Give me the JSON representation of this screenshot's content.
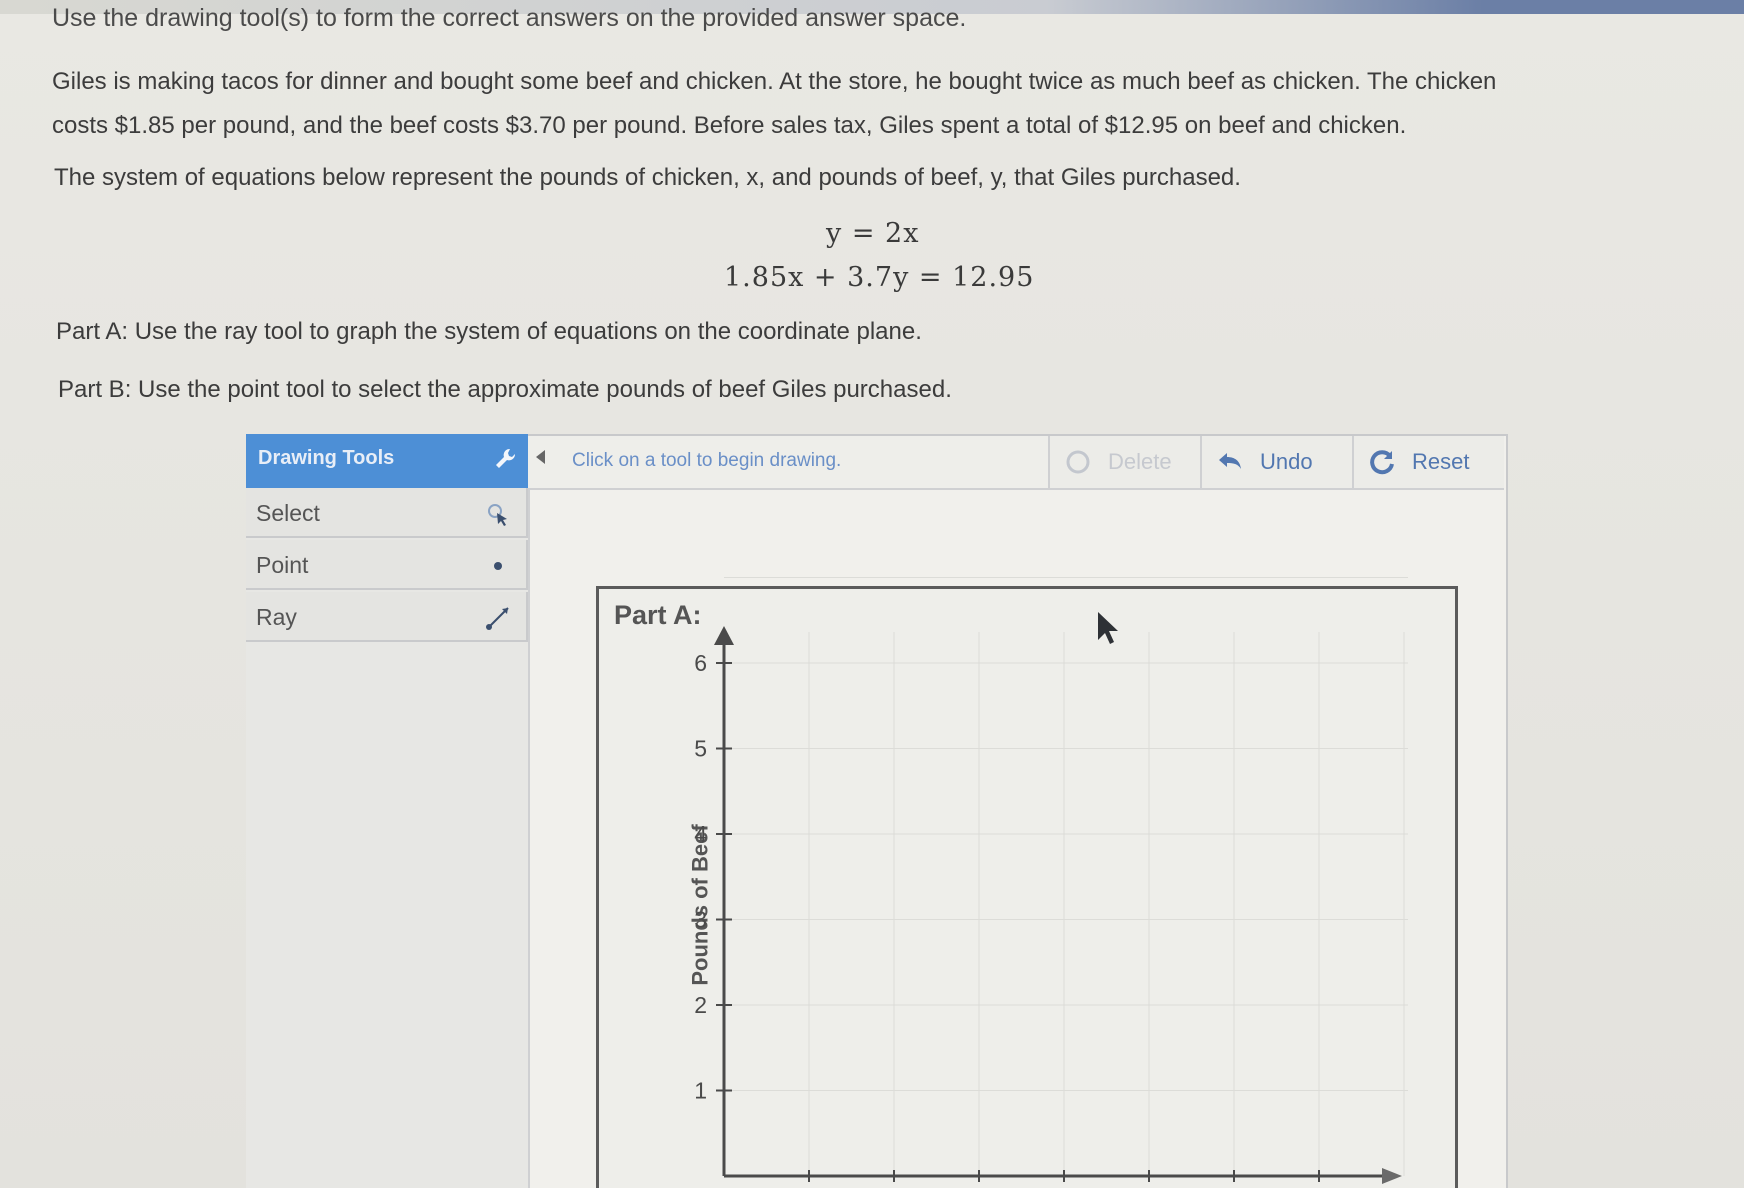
{
  "instruction": "Use the drawing tool(s) to form the correct answers on the provided answer space.",
  "problem": {
    "line1": "Giles is making tacos for dinner and bought some beef and chicken. At the store, he bought twice as much beef as chicken. The chicken",
    "line2": "costs $1.85 per pound, and the beef costs $3.70 per pound. Before sales tax, Giles spent a total of $12.95 on beef and chicken.",
    "line3": "The system of equations below represent the pounds of chicken, x, and pounds of beef, y, that Giles purchased."
  },
  "equations": {
    "eq1": "y = 2x",
    "eq2": "1.85x + 3.7y = 12.95"
  },
  "parts": {
    "part_a": "Part A: Use the ray tool to graph the system of equations on the coordinate plane.",
    "part_b": "Part B: Use the point tool to select the approximate pounds of beef Giles purchased."
  },
  "toolbar": {
    "header": "Drawing Tools",
    "tools": [
      "Select",
      "Point",
      "Ray"
    ],
    "message": "Click on a tool to begin drawing.",
    "delete_label": "Delete",
    "undo_label": "Undo",
    "reset_label": "Reset"
  },
  "graph": {
    "title": "Part A:",
    "ylabel": "Pounds of Beef",
    "y_ticks": [
      "1",
      "2",
      "3",
      "4",
      "5",
      "6"
    ]
  },
  "colors": {
    "header_blue": "#4d8fd6",
    "button_text": "#5277b0",
    "message_text": "#6a8fc7"
  }
}
